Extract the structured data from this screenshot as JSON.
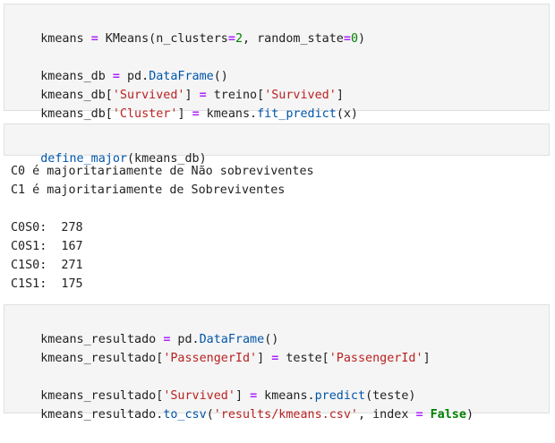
{
  "cell1": {
    "line1": {
      "a": "kmeans ",
      "op": "=",
      "b": " KMeans(n_clusters",
      "op2": "=",
      "num1": "2",
      "c": ", random_state",
      "op3": "=",
      "num2": "0",
      "d": ")"
    },
    "line2": {
      "a": "kmeans_db ",
      "op": "=",
      "b": " pd.",
      "fn": "DataFrame",
      "c": "()"
    },
    "line3": {
      "a": "kmeans_db[",
      "s1": "'Survived'",
      "b": "] ",
      "op": "=",
      "c": " treino[",
      "s2": "'Survived'",
      "d": "]"
    },
    "line4": {
      "a": "kmeans_db[",
      "s1": "'Cluster'",
      "b": "] ",
      "op": "=",
      "c": " kmeans.",
      "fn": "fit_predict",
      "d": "(x)"
    }
  },
  "cell2": {
    "line1": {
      "fn": "define_major",
      "a": "(kmeans_db)"
    }
  },
  "output": {
    "lines": [
      "C0 é majoritariamente de Não sobreviventes",
      "C1 é majoritariamente de Sobreviventes",
      "C0S0:  278",
      "C0S1:  167",
      "C1S0:  271",
      "C1S1:  175"
    ]
  },
  "cell3": {
    "line1": {
      "a": "kmeans_resultado ",
      "op": "=",
      "b": " pd.",
      "fn": "DataFrame",
      "c": "()"
    },
    "line2": {
      "a": "kmeans_resultado[",
      "s1": "'PassengerId'",
      "b": "] ",
      "op": "=",
      "c": " teste[",
      "s2": "'PassengerId'",
      "d": "]"
    },
    "line3": {
      "a": "kmeans_resultado[",
      "s1": "'Survived'",
      "b": "] ",
      "op": "=",
      "c": " kmeans.",
      "fn": "predict",
      "d": "(teste)"
    },
    "line4": {
      "a": "kmeans_resultado.",
      "fn": "to_csv",
      "b": "(",
      "s1": "'results/kmeans.csv'",
      "c": ", index ",
      "op": "=",
      "d": " ",
      "kw": "False",
      "e": ")"
    }
  }
}
